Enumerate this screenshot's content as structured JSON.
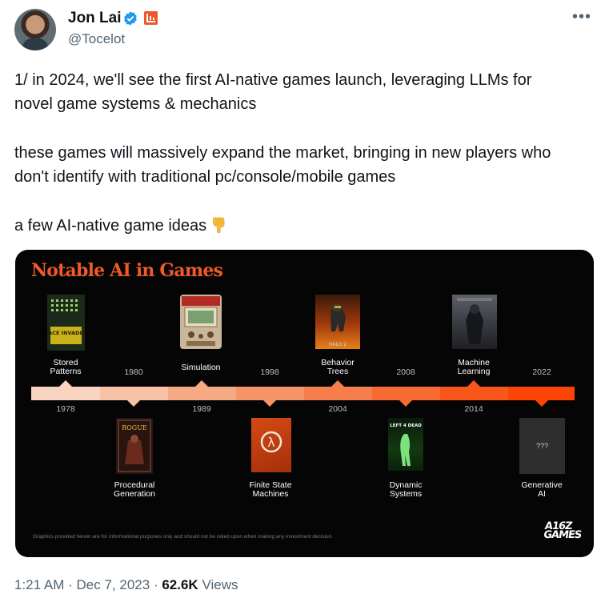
{
  "author": {
    "name": "Jon Lai",
    "handle": "@Tocelot"
  },
  "tweet": {
    "line1": "1/ in 2024, we'll see the first AI-native games launch, leveraging LLMs for",
    "line2": "novel game systems & mechanics",
    "line3": "these games will massively expand the market, bringing in new players who",
    "line4": "don't identify with traditional pc/console/mobile games",
    "line5": "a few AI-native game ideas"
  },
  "card": {
    "title": "Notable AI in Games",
    "top_labels": [
      {
        "line1": "Stored",
        "line2": "Patterns"
      },
      {
        "line1": "Simulation",
        "line2": ""
      },
      {
        "line1": "Behavior",
        "line2": "Trees"
      },
      {
        "line1": "Machine",
        "line2": "Learning"
      }
    ],
    "bottom_labels": [
      {
        "line1": "Procedural",
        "line2": "Generation"
      },
      {
        "line1": "Finite State",
        "line2": "Machines"
      },
      {
        "line1": "Dynamic",
        "line2": "Systems"
      },
      {
        "line1": "Generative",
        "line2": "AI"
      }
    ],
    "years_above": [
      "1980",
      "1998",
      "2008",
      "2022"
    ],
    "years_below": [
      "1978",
      "1989",
      "2004",
      "2014"
    ],
    "thumbs": {
      "space_invaders": "SPACE INVADERS",
      "rogue": "ROGUE",
      "halo": "HALO 2",
      "l4d": "LEFT 4 DEAD",
      "gen_ai": "???"
    },
    "disclaimer": "Graphics provided herein are for informational purposes only and should not be relied upon when making any investment decision.",
    "logo_top": "A16Z",
    "logo_bottom": "GAMES",
    "colors": {
      "accent": "#f05a28",
      "bar_start": "#f7d0bc",
      "bar_end": "#ff4a00",
      "background": "#050505"
    }
  },
  "meta": {
    "time": "1:21 AM",
    "date": "Dec 7, 2023",
    "views": "62.6K",
    "views_label": "Views",
    "sep": "·"
  }
}
